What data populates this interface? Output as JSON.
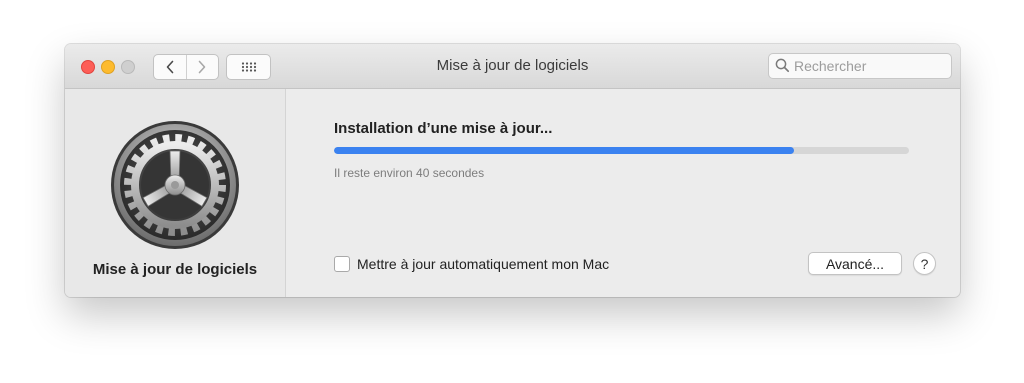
{
  "window": {
    "title": "Mise à jour de logiciels",
    "traffic_lights": {
      "close": "#fd5e57",
      "minimize": "#fdbb2e",
      "zoom": "#cfcfcf"
    }
  },
  "toolbar": {
    "back_icon": "chevron-left-icon",
    "forward_icon": "chevron-right-icon",
    "show_all_icon": "grid-icon",
    "search": {
      "placeholder": "Rechercher",
      "value": "",
      "icon": "search-icon"
    }
  },
  "sidebar": {
    "icon": "gear-icon",
    "label": "Mise à jour de logiciels"
  },
  "main": {
    "status_heading": "Installation d’une mise à jour...",
    "progress": {
      "fraction": 0.8,
      "color": "#3b82f0"
    },
    "time_remaining": "Il reste environ 40 secondes",
    "auto_update": {
      "label": "Mettre à jour automatiquement mon Mac",
      "checked": false
    },
    "advanced_button": "Avancé...",
    "help_button": "?"
  }
}
